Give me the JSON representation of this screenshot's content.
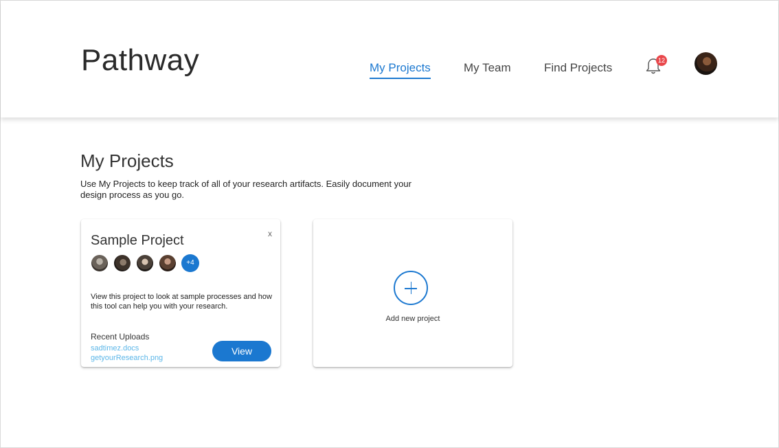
{
  "app": {
    "title": "Pathway"
  },
  "nav": {
    "items": [
      {
        "label": "My Projects",
        "active": true
      },
      {
        "label": "My Team",
        "active": false
      },
      {
        "label": "Find Projects",
        "active": false
      }
    ],
    "notifications_count": "12"
  },
  "page": {
    "title": "My Projects",
    "description": "Use My Projects to keep track of all of your research artifacts. Easily document your design process as you go."
  },
  "project_card": {
    "close_label": "x",
    "title": "Sample Project",
    "more_members": "+4",
    "description": "View this project to look at sample processes and how this tool can help you with your research.",
    "recent_uploads_label": "Recent Uploads",
    "files": [
      "sadtimez.docs",
      "getyourResearch.png"
    ],
    "view_label": "View"
  },
  "add_card": {
    "label": "Add new project"
  },
  "colors": {
    "accent": "#1b78d0",
    "badge": "#e9474b",
    "link": "#5bb6e8"
  }
}
